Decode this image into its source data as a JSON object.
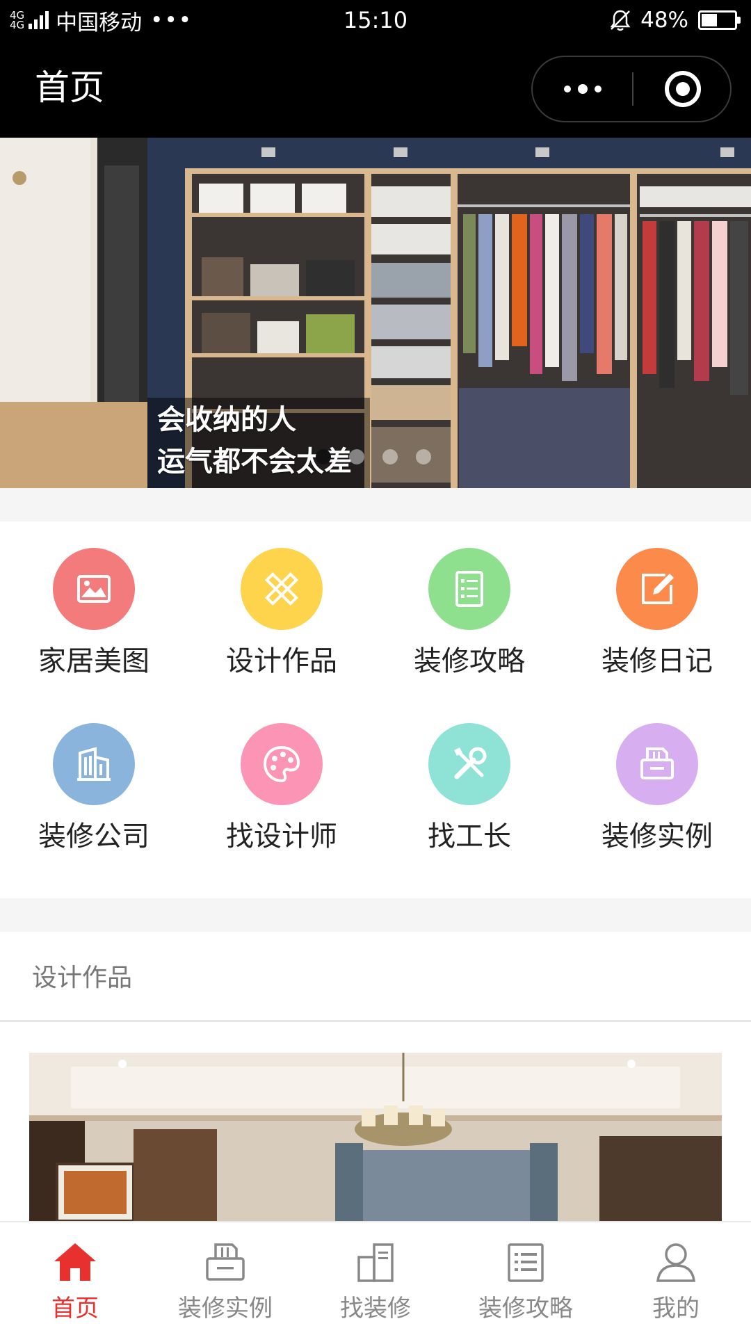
{
  "status_bar": {
    "network": "4G",
    "carrier": "中国移动",
    "more": "•••",
    "time": "15:10",
    "battery": "48%",
    "battery_level": 0.48
  },
  "nav": {
    "title": "首页"
  },
  "banner": {
    "caption_line1": "会收纳的人",
    "caption_line2": "运气都不会太差",
    "active_index": 0
  },
  "grid": {
    "items": [
      {
        "label": "家居美图",
        "icon": "image-icon",
        "color": "#f47b7b"
      },
      {
        "label": "设计作品",
        "icon": "ruler-pencil-icon",
        "color": "#fdd44c"
      },
      {
        "label": "装修攻略",
        "icon": "list-doc-icon",
        "color": "#8fe08e"
      },
      {
        "label": "装修日记",
        "icon": "edit-icon",
        "color": "#fb8a4b"
      },
      {
        "label": "装修公司",
        "icon": "building-icon",
        "color": "#8ab4dc"
      },
      {
        "label": "找设计师",
        "icon": "palette-icon",
        "color": "#fc95b5"
      },
      {
        "label": "找工长",
        "icon": "tools-icon",
        "color": "#8ee2d6"
      },
      {
        "label": "装修实例",
        "icon": "printer-icon",
        "color": "#d7aff0"
      }
    ]
  },
  "section": {
    "title": "设计作品"
  },
  "tab_bar": {
    "items": [
      {
        "label": "首页",
        "icon": "home-icon",
        "active": true
      },
      {
        "label": "装修实例",
        "icon": "printer-icon",
        "active": false
      },
      {
        "label": "找装修",
        "icon": "building-icon",
        "active": false
      },
      {
        "label": "装修攻略",
        "icon": "list-doc-icon",
        "active": false
      },
      {
        "label": "我的",
        "icon": "user-icon",
        "active": false
      }
    ],
    "active_color": "#e8312f",
    "inactive_color": "#888888"
  }
}
